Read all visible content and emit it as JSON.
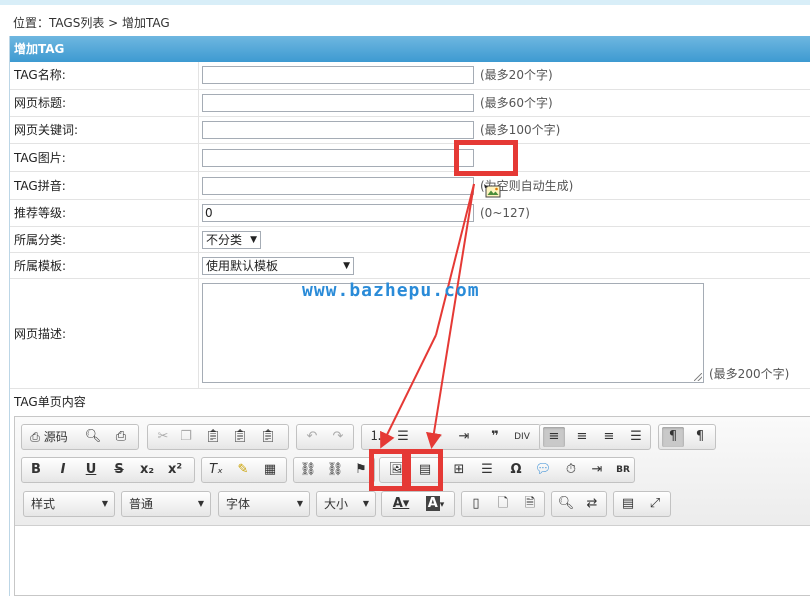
{
  "breadcrumb": "位置：TAGS列表 > 增加TAG",
  "panel_title": "增加TAG",
  "fields": {
    "name": {
      "label": "TAG名称:",
      "value": "",
      "hint": "(最多20个字)"
    },
    "title": {
      "label": "网页标题:",
      "value": "",
      "hint": "(最多60个字)"
    },
    "keywords": {
      "label": "网页关键词:",
      "value": "",
      "hint": "(最多100个字)"
    },
    "image": {
      "label": "TAG图片:",
      "value": ""
    },
    "pinyin": {
      "label": "TAG拼音:",
      "value": "",
      "hint": "(为空则自动生成)"
    },
    "level": {
      "label": "推荐等级:",
      "value": "0",
      "hint": "(0~127)"
    },
    "category": {
      "label": "所属分类:",
      "selected": "不分类"
    },
    "template": {
      "label": "所属模板:",
      "selected": "使用默认模板"
    },
    "description": {
      "label": "网页描述:",
      "value": "",
      "hint": "(最多200个字)"
    },
    "content": {
      "label": "TAG单页内容"
    }
  },
  "editor": {
    "source_label": "源码",
    "combos": {
      "style": "样式",
      "format": "普通",
      "font": "字体",
      "size": "大小"
    }
  },
  "watermark": "www.bazhepu.com",
  "colors": {
    "header": "#3d9ad1",
    "highlight": "#e53935",
    "watermark": "#2a8bd8"
  }
}
